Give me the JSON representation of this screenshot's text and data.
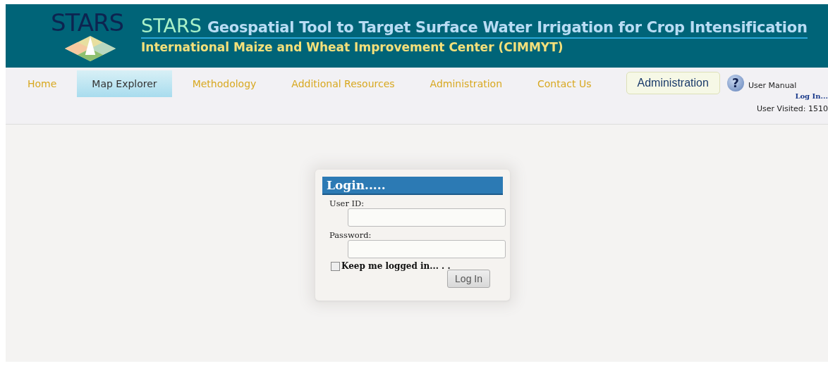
{
  "header": {
    "logo_text": "STARS",
    "brand": "STARS",
    "title": "Geospatial Tool to Target Surface Water Irrigation for Crop Intensification",
    "subtitle": "International Maize and Wheat Improvement Center (CIMMYT)"
  },
  "nav": [
    {
      "label": "Home",
      "selected": false
    },
    {
      "label": "Map Explorer",
      "selected": true
    },
    {
      "label": "Methodology",
      "selected": false
    },
    {
      "label": "Additional Resources",
      "selected": false
    },
    {
      "label": "Administration",
      "selected": false
    },
    {
      "label": "Contact Us",
      "selected": false
    }
  ],
  "admin_button": "Administration",
  "help": {
    "icon_text": "?",
    "label": "User Manual"
  },
  "login_link": "Log In...",
  "visits": "User Visited: 1510",
  "login": {
    "title": "Login.....",
    "user_label": "User ID:",
    "password_label": "Password:",
    "keep_logged_in": {
      "label": "Keep me logged in... . .",
      "checked": false
    },
    "button": "Log In"
  }
}
